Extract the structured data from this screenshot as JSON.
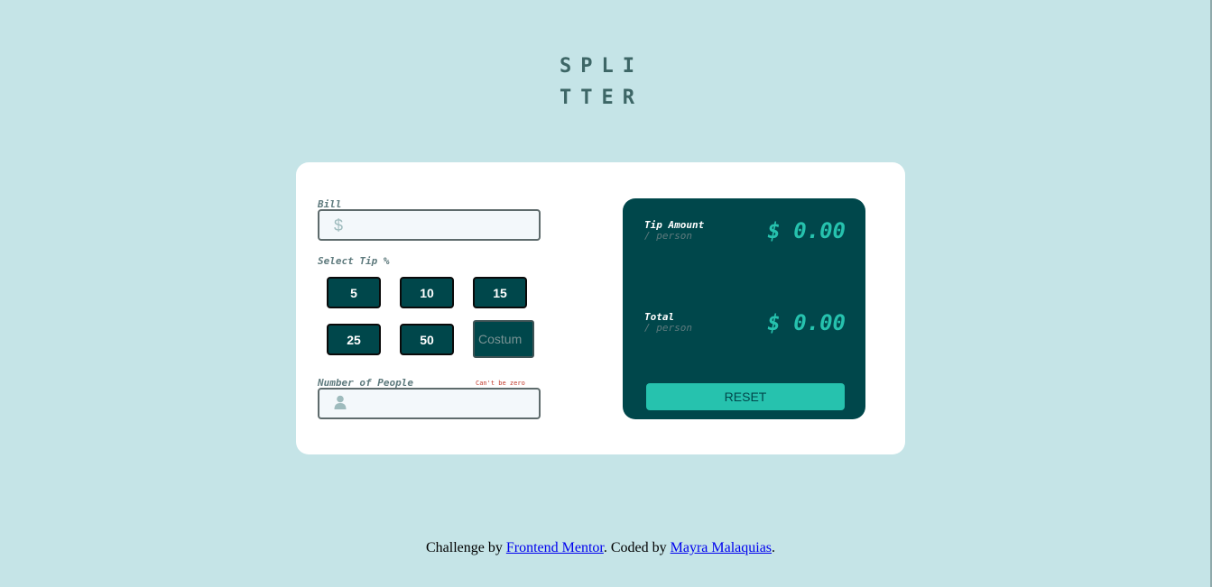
{
  "logo": {
    "line1": "SPLI",
    "line2": "TTER"
  },
  "calculator": {
    "bill": {
      "label": "Bill",
      "icon": "dollar-icon",
      "icon_glyph": "$",
      "value": ""
    },
    "tip": {
      "label": "Select Tip %",
      "options": [
        "5",
        "10",
        "15",
        "25",
        "50"
      ],
      "custom_placeholder": "Costum"
    },
    "people": {
      "label": "Number of People",
      "error": "Can't be zero",
      "icon": "person-icon",
      "value": ""
    }
  },
  "results": {
    "tip_amount": {
      "label": "Tip Amount",
      "sub": "/ person",
      "value": "$ 0.00"
    },
    "total": {
      "label": "Total",
      "sub": "/ person",
      "value": "$ 0.00"
    },
    "reset_label": "RESET"
  },
  "footer": {
    "prefix": "Challenge by ",
    "link1": "Frontend Mentor",
    "middle": ". Coded by ",
    "link2": "Mayra Malaquias",
    "suffix": "."
  },
  "colors": {
    "background": "#c5e4e7",
    "dark_cyan": "#00474b",
    "strong_cyan": "#26c2ae",
    "error": "#c0392b"
  }
}
